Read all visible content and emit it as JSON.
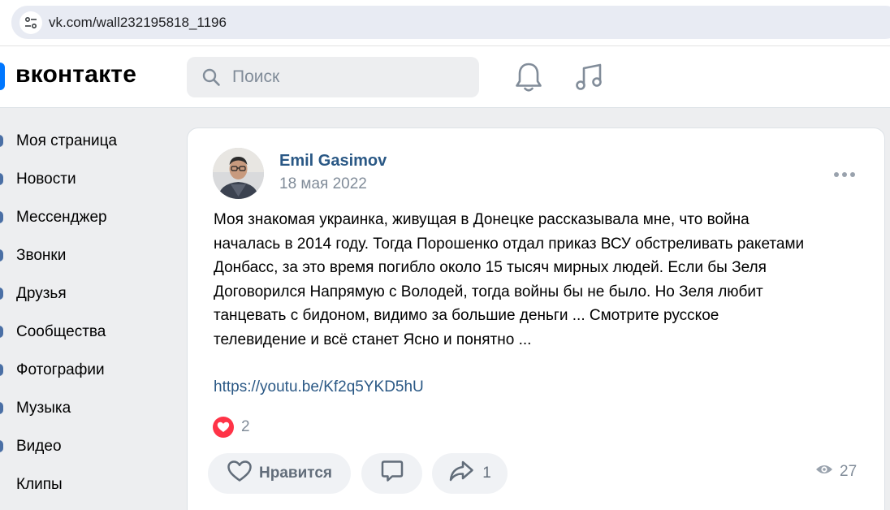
{
  "browser": {
    "url": "vk.com/wall232195818_1196"
  },
  "header": {
    "logo": "вконтакте",
    "search_placeholder": "Поиск"
  },
  "sidebar": {
    "items": [
      {
        "label": "Моя страница"
      },
      {
        "label": "Новости"
      },
      {
        "label": "Мессенджер"
      },
      {
        "label": "Звонки"
      },
      {
        "label": "Друзья"
      },
      {
        "label": "Сообщества"
      },
      {
        "label": "Фотографии"
      },
      {
        "label": "Музыка"
      },
      {
        "label": "Видео"
      },
      {
        "label": "Клипы"
      }
    ]
  },
  "post": {
    "author": "Emil Gasimov",
    "date": "18 мая 2022",
    "text_lines": [
      "Моя знакомая украинка, живущая в Донецке рассказывала мне, что война",
      "началась в 2014 году. Тогда Порошенко отдал приказ ВСУ обстреливать ракетами",
      "Донбасс, за это время погибло около 15 тысяч мирных людей. Если бы Зеля",
      "Договорился Напрямую с Володей, тогда войны бы не было. Но Зеля любит",
      "танцевать с бидоном, видимо за большие деньги ... Смотрите русское",
      "телевидение и всё станет Ясно и понятно ..."
    ],
    "link": "https://youtu.be/Kf2q5YKD5hU",
    "reactions_count": "2",
    "like_label": "Нравится",
    "share_count": "1",
    "views": "27"
  },
  "colors": {
    "accent": "#0077ff",
    "link": "#2a5885",
    "secondary_text": "#818c99",
    "reaction": "#ff3347",
    "page_bg": "#edeef0"
  },
  "icons": {
    "site": "tune-icon",
    "search": "search-icon",
    "bell": "bell-icon",
    "music": "music-note-icon",
    "more": "more-dots-icon",
    "heart": "heart-icon",
    "comment": "comment-icon",
    "share": "share-icon",
    "views": "eye-icon"
  }
}
